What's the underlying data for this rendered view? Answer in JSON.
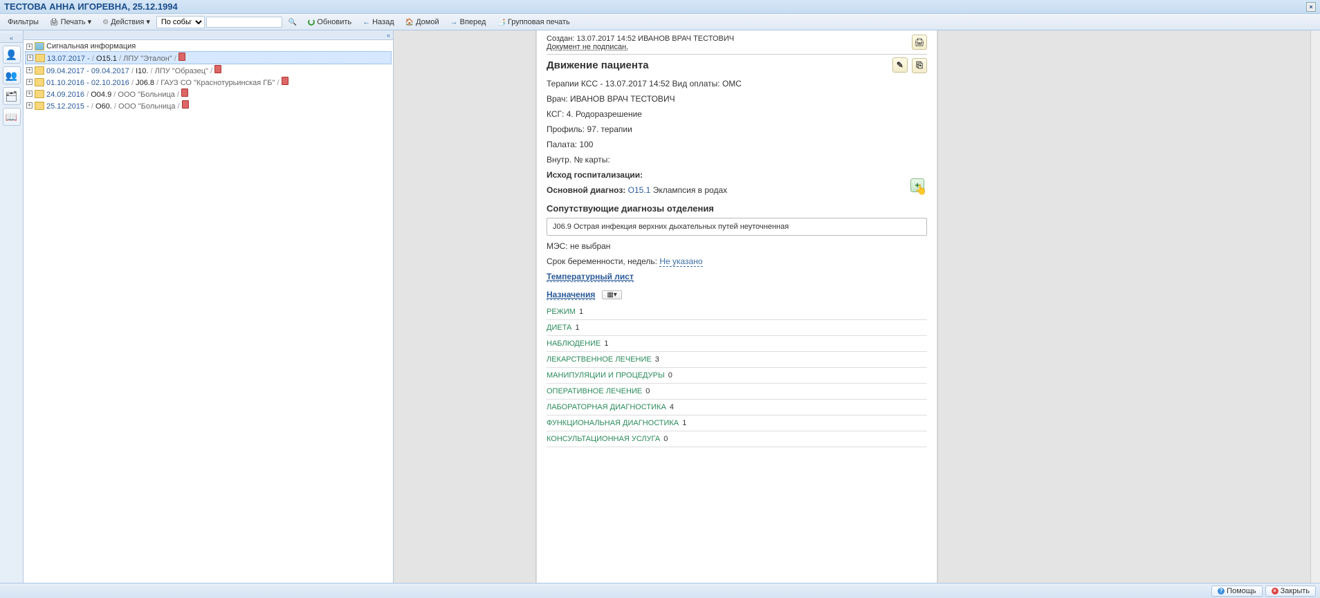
{
  "title": "ТЕСТОВА АННА ИГОРЕВНА, 25.12.1994",
  "toolbar": {
    "filters": "Фильтры",
    "print": "Печать",
    "actions": "Действия",
    "view_mode": "По событиям",
    "refresh": "Обновить",
    "back": "Назад",
    "home": "Домой",
    "forward": "Вперед",
    "group_print": "Групповая печать"
  },
  "tree": {
    "signal": "Сигнальная информация",
    "rows": [
      {
        "date": "13.07.2017 -",
        "code": "O15.1",
        "lpu": "ЛПУ \"Эталон\"",
        "selected": true
      },
      {
        "date": "09.04.2017 - 09.04.2017",
        "code": "I10.",
        "lpu": "ЛПУ \"Образец\"",
        "selected": false
      },
      {
        "date": "01.10.2016 - 02.10.2016",
        "code": "J06.8",
        "lpu": "ГАУЗ СО \"Краснотурьинская ГБ\"",
        "selected": false
      },
      {
        "date": "24.09.2016",
        "code": "O04.9",
        "lpu": "ООО \"Больница",
        "selected": false,
        "blue": true
      },
      {
        "date": "25.12.2015 -",
        "code": "O60.",
        "lpu": "ООО \"Больница",
        "selected": false
      }
    ]
  },
  "doc": {
    "created_label": "Создан:",
    "created": "13.07.2017 14:52 ИВАНОВ ВРАЧ ТЕСТОВИЧ",
    "unsigned": "Документ не подписан.",
    "heading": "Движение пациента",
    "dept_line": "Терапии КСС - 13.07.2017 14:52 Вид оплаты: ОМС",
    "doctor_label": "Врач:",
    "doctor": "ИВАНОВ ВРАЧ ТЕСТОВИЧ",
    "ksg_label": "КСГ:",
    "ksg": "4. Родоразрешение",
    "profile_label": "Профиль:",
    "profile": "97. терапии",
    "ward_label": "Палата:",
    "ward": "100",
    "card_label": "Внутр. № карты:",
    "outcome_label": "Исход госпитализации:",
    "main_diag_label": "Основной диагноз:",
    "main_diag_code": "O15.1",
    "main_diag_text": "Эклампсия в родах",
    "comorbid_title": "Сопутствующие диагнозы отделения",
    "comorbid_item": "J06.9 Острая инфекция верхних дыхательных путей неуточненная",
    "mes": "МЭС: не выбран",
    "preg_label": "Срок беременности, недель:",
    "preg_val": "Не указано",
    "temp_sheet": "Температурный лист",
    "presc_title": "Назначения",
    "presc": [
      {
        "name": "РЕЖИМ",
        "cnt": "1"
      },
      {
        "name": "ДИЕТА",
        "cnt": "1"
      },
      {
        "name": "НАБЛЮДЕНИЕ",
        "cnt": "1"
      },
      {
        "name": "ЛЕКАРСТВЕННОЕ ЛЕЧЕНИЕ",
        "cnt": "3"
      },
      {
        "name": "МАНИПУЛЯЦИИ И ПРОЦЕДУРЫ",
        "cnt": "0"
      },
      {
        "name": "ОПЕРАТИВНОЕ ЛЕЧЕНИЕ",
        "cnt": "0"
      },
      {
        "name": "ЛАБОРАТОРНАЯ ДИАГНОСТИКА",
        "cnt": "4"
      },
      {
        "name": "ФУНКЦИОНАЛЬНАЯ ДИАГНОСТИКА",
        "cnt": "1"
      },
      {
        "name": "КОНСУЛЬТАЦИОННАЯ УСЛУГА",
        "cnt": "0"
      }
    ]
  },
  "footer": {
    "help": "Помощь",
    "close": "Закрыть"
  }
}
